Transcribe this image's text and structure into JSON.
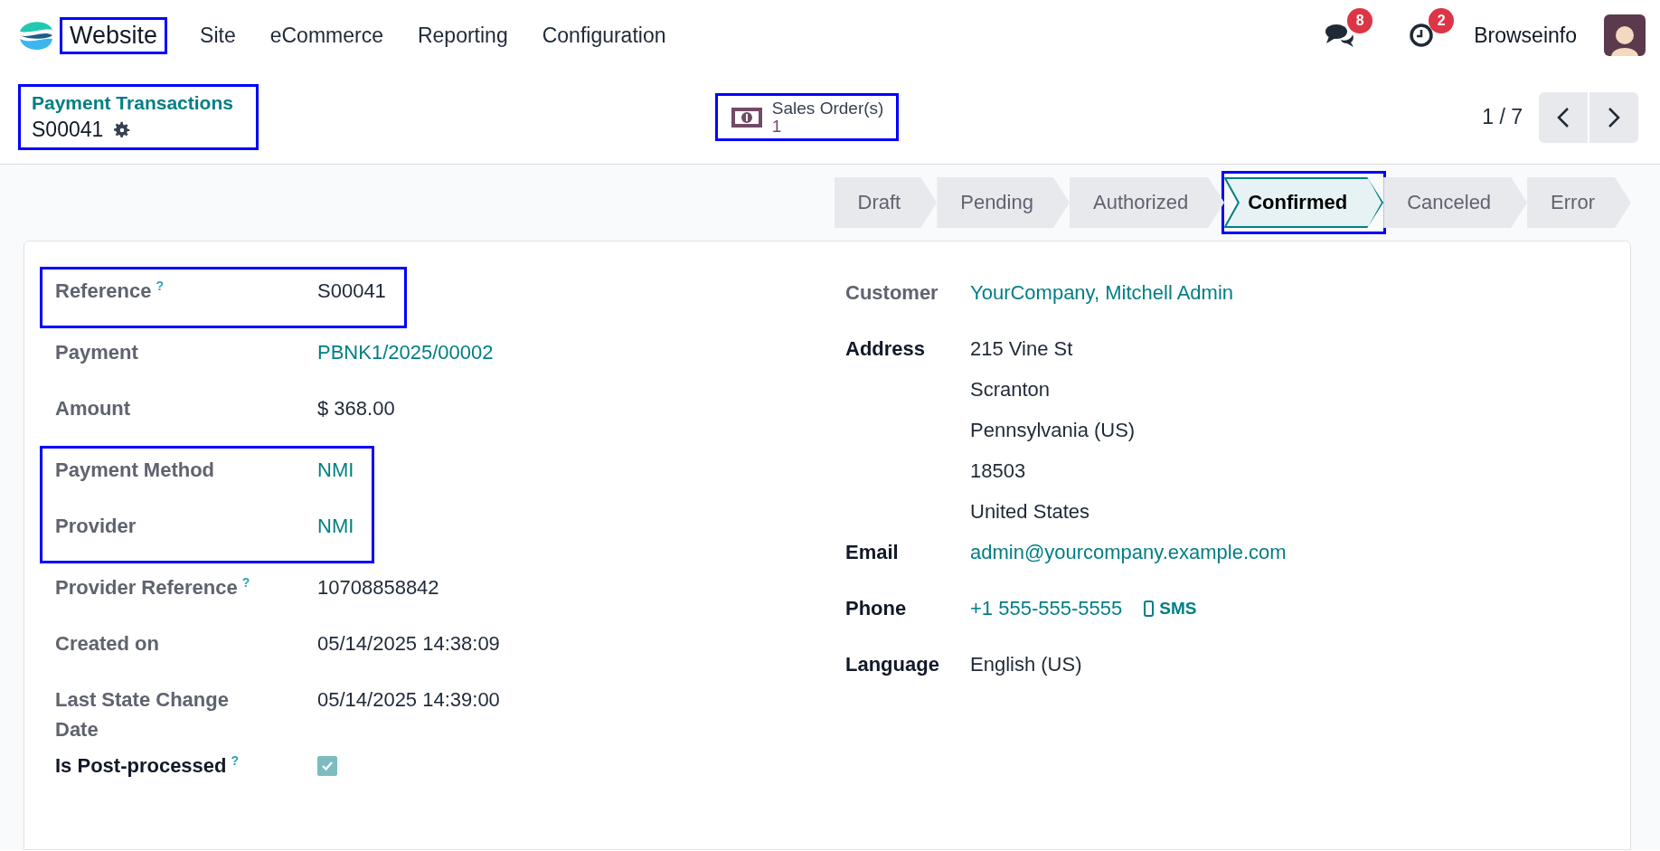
{
  "navbar": {
    "app": {
      "label": "Website",
      "highlighted": true
    },
    "menu": [
      "Site",
      "eCommerce",
      "Reporting",
      "Configuration"
    ],
    "messages_badge": "8",
    "activities_badge": "2",
    "user": "Browseinfo"
  },
  "control_panel": {
    "breadcrumb": "Payment Transactions",
    "record": "S00041",
    "highlighted": true,
    "smart_button": {
      "label": "Sales Order(s)",
      "value": "1",
      "highlighted": true
    },
    "pager": "1 / 7"
  },
  "stages": [
    {
      "label": "Draft",
      "selected": false,
      "highlighted": false
    },
    {
      "label": "Pending",
      "selected": false,
      "highlighted": false
    },
    {
      "label": "Authorized",
      "selected": false,
      "highlighted": false
    },
    {
      "label": "Confirmed",
      "selected": true,
      "highlighted": true
    },
    {
      "label": "Canceled",
      "selected": false,
      "highlighted": false
    },
    {
      "label": "Error",
      "selected": false,
      "highlighted": false
    }
  ],
  "left_groups": [
    {
      "highlighted": true,
      "fields": [
        {
          "label": "Reference",
          "help": "?",
          "value": "S00041",
          "kind": "text",
          "strong": false
        }
      ]
    },
    {
      "highlighted": false,
      "fields": [
        {
          "label": "Payment",
          "value": "PBNK1/2025/00002",
          "kind": "link",
          "strong": false
        },
        {
          "label": "Amount",
          "value": "$ 368.00",
          "kind": "text",
          "strong": false
        }
      ]
    },
    {
      "highlighted": true,
      "fields": [
        {
          "label": "Payment Method",
          "value": "NMI",
          "kind": "link",
          "strong": false
        },
        {
          "label": "Provider",
          "value": "NMI",
          "kind": "link",
          "strong": false
        }
      ]
    },
    {
      "highlighted": false,
      "fields": [
        {
          "label": "Provider Reference",
          "help": "?",
          "value": "10708858842",
          "kind": "text",
          "strong": false
        },
        {
          "label": "Created on",
          "value": "05/14/2025 14:38:09",
          "kind": "text",
          "strong": false
        },
        {
          "label": "Last State Change Date",
          "value": "05/14/2025 14:39:00",
          "kind": "text",
          "strong": false
        },
        {
          "label": "Is Post-processed",
          "help": "?",
          "kind": "checkbox",
          "checked": true,
          "strong": true
        }
      ]
    }
  ],
  "right_fields": [
    {
      "label": "Customer",
      "kind": "link",
      "value": "YourCompany, Mitchell Admin",
      "strong": false
    },
    {
      "label": "Address",
      "kind": "lines",
      "lines": [
        "215 Vine St",
        "Scranton",
        "Pennsylvania (US)",
        "18503",
        "United States"
      ],
      "strong": true
    },
    {
      "label": "Email",
      "kind": "link",
      "value": "admin@yourcompany.example.com",
      "strong": true
    },
    {
      "label": "Phone",
      "kind": "phone",
      "value": "+1 555-555-5555",
      "action": "SMS",
      "strong": true
    },
    {
      "label": "Language",
      "kind": "text",
      "value": "English (US)",
      "strong": true
    }
  ]
}
